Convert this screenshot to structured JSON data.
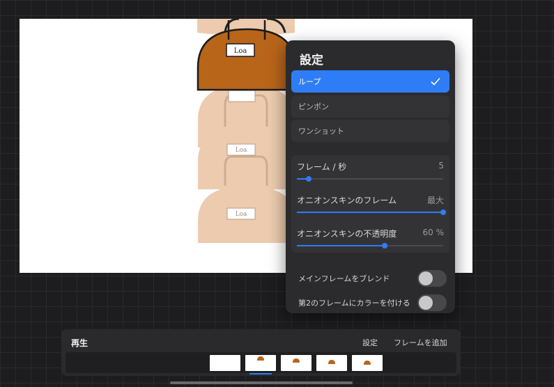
{
  "settings": {
    "title": "設定",
    "modes": [
      {
        "label": "ループ",
        "selected": true
      },
      {
        "label": "ピンポン",
        "selected": false
      },
      {
        "label": "ワンショット",
        "selected": false
      }
    ],
    "sliders": [
      {
        "label": "フレーム / 秒",
        "value": "5",
        "level": 0.08
      },
      {
        "label": "オニオンスキンのフレーム",
        "value": "最大",
        "level": 1.0
      },
      {
        "label": "オニオンスキンの不透明度",
        "value": "60 %",
        "level": 0.6
      }
    ],
    "toggles": [
      {
        "label": "メインフレームをブレンド",
        "on": false
      },
      {
        "label": "第2のフレームにカラーを付ける",
        "on": false
      }
    ]
  },
  "timeline": {
    "play": "再生",
    "settings": "設定",
    "add_frame": "フレームを追加",
    "frames": [
      1,
      2,
      3,
      4,
      5
    ],
    "selected_frame": 2
  },
  "canvas": {
    "bag_tag": "Loa"
  },
  "colors": {
    "accent": "#2f7df6",
    "bag": "#b8651a",
    "onion": "#e9c3a0"
  },
  "icons": {
    "check": "check-icon"
  }
}
